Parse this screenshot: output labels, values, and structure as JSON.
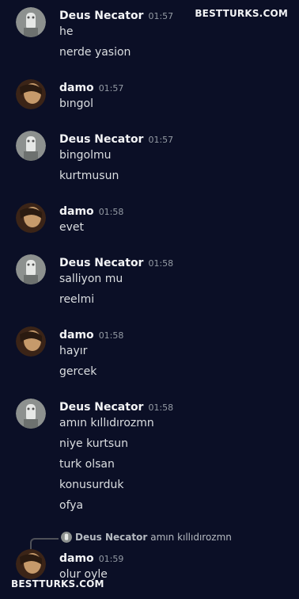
{
  "watermark": {
    "top": "BESTTURKS.COM",
    "bottom": "BESTTURKS.COM"
  },
  "groups": [
    {
      "user": "Deus Necator",
      "time": "01:57",
      "messages": [
        "he",
        "nerde yasion"
      ]
    },
    {
      "user": "damo",
      "time": "01:57",
      "messages": [
        "bıngol"
      ]
    },
    {
      "user": "Deus Necator",
      "time": "01:57",
      "messages": [
        "bingolmu",
        "kurtmusun"
      ]
    },
    {
      "user": "damo",
      "time": "01:58",
      "messages": [
        "evet"
      ]
    },
    {
      "user": "Deus Necator",
      "time": "01:58",
      "messages": [
        "salliyon mu",
        "reelmi"
      ]
    },
    {
      "user": "damo",
      "time": "01:58",
      "messages": [
        "hayır",
        "gercek"
      ]
    },
    {
      "user": "Deus Necator",
      "time": "01:58",
      "messages": [
        "amın kıllıdırozmn",
        "niye kurtsun",
        "turk olsan",
        "konusurduk",
        "ofya"
      ]
    },
    {
      "user": "damo",
      "time": "01:59",
      "messages": [
        "olur oyle"
      ]
    }
  ],
  "reply": {
    "user": "Deus Necator",
    "text": "amın kıllıdırozmn"
  },
  "colors": {
    "background": "#0b0f26",
    "username": "#f2f3f5",
    "timestamp": "#949ba4",
    "message": "#dbdee1"
  }
}
